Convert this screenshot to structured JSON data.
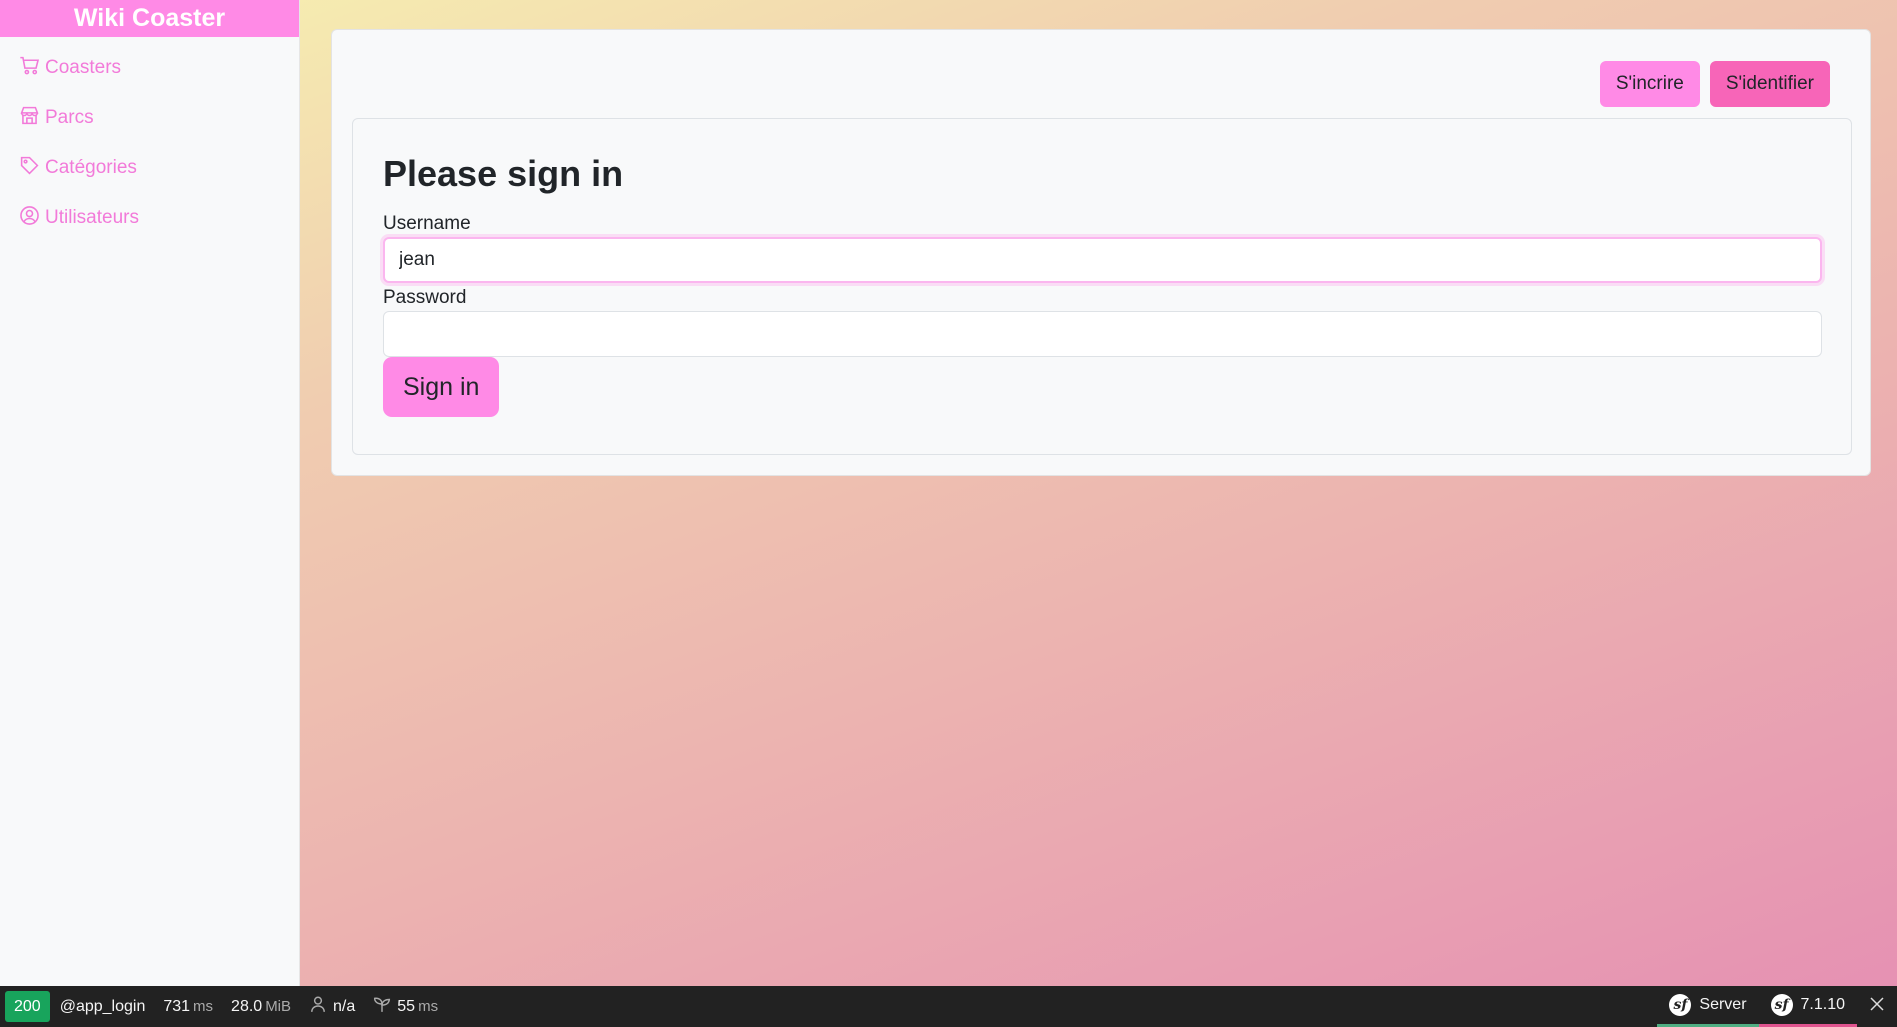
{
  "sidebar": {
    "brand": "Wiki Coaster",
    "items": [
      {
        "label": "Coasters",
        "icon": "cart-icon"
      },
      {
        "label": "Parcs",
        "icon": "shop-icon"
      },
      {
        "label": "Catégories",
        "icon": "tags-icon"
      },
      {
        "label": "Utilisateurs",
        "icon": "user-circle-icon"
      }
    ]
  },
  "header": {
    "register_label": "S'incrire",
    "login_label": "S'identifier"
  },
  "login": {
    "title": "Please sign in",
    "username_label": "Username",
    "username_value": "jean",
    "password_label": "Password",
    "password_value": "",
    "submit_label": "Sign in"
  },
  "toolbar": {
    "status": "200",
    "route": "@app_login",
    "time": "731",
    "time_unit": "ms",
    "memory": "28.0",
    "memory_unit": "MiB",
    "user": "n/a",
    "twig_time": "55",
    "twig_unit": "ms",
    "server_label": "Server",
    "version": "7.1.10"
  },
  "colors": {
    "accent": "#ff8ae6",
    "accent_dark": "#f765b8",
    "nav_link": "#f27ad9",
    "status_ok": "#18a45c"
  }
}
